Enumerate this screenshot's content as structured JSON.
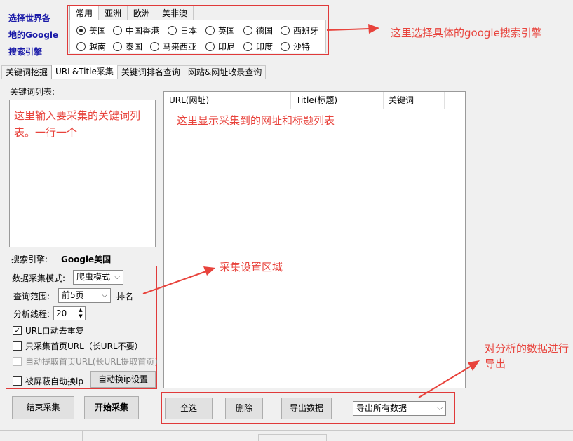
{
  "brand": {
    "line1": "选择世界各",
    "line2": "地的Google",
    "line3": "搜索引擎"
  },
  "region_tabs": [
    "常用",
    "亚洲",
    "欧洲",
    "美非澳"
  ],
  "countries_row1": [
    "美国",
    "中国香港",
    "日本",
    "英国",
    "德国",
    "西班牙"
  ],
  "countries_row2": [
    "越南",
    "泰国",
    "马来西亚",
    "印尼",
    "印度",
    "沙特"
  ],
  "selected_country": "美国",
  "annotations": {
    "engine": "这里选择具体的google搜索引擎",
    "keywords": "这里输入要采集的关键词列表。一行一个",
    "results": "这里显示采集到的网址和标题列表",
    "settings": "采集设置区域",
    "export": "对分析的数据进行导出"
  },
  "main_tabs": [
    "关键词挖掘",
    "URL&Title采集",
    "关键词排名查询",
    "网站&网址收录查询"
  ],
  "active_tab": "URL&Title采集",
  "keyword_list_label": "关键词列表:",
  "columns": [
    "URL(网址)",
    "Title(标题)",
    "关键词"
  ],
  "engine_label": "搜索引擎:",
  "engine_value": "Google美国",
  "settings": {
    "mode_label": "数据采集模式:",
    "mode_value": "爬虫模式",
    "range_label": "查询范围:",
    "range_value": "前5页",
    "rank_label": "排名",
    "threads_label": "分析线程:",
    "threads_value": "20",
    "dedupe_label": "URL自动去重复",
    "dedupe_checked": true,
    "homepage_only_label": "只采集首页URL（长URL不要）",
    "auto_extract_label": "自动提取首页URL(长URL提取首页)",
    "auto_ip_label": "被屏蔽自动换ip",
    "auto_ip_button": "自动换ip设置"
  },
  "buttons": {
    "stop": "结束采集",
    "start": "开始采集",
    "select_all": "全选",
    "delete": "删除",
    "export": "导出数据",
    "export_option": "导出所有数据"
  },
  "colors": {
    "annotation": "#e8433c",
    "brand": "#1a1aa8"
  }
}
